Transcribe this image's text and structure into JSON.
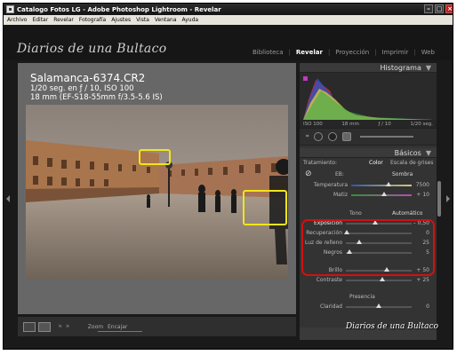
{
  "window": {
    "title": "Catalogo Fotos LG - Adobe Photoshop Lightroom - Revelar"
  },
  "menu": [
    "Archivo",
    "Editar",
    "Revelar",
    "Fotografía",
    "Ajustes",
    "Vista",
    "Ventana",
    "Ayuda"
  ],
  "identity_plate": "Diarios de una Bultaco",
  "modules": {
    "items": [
      "Biblioteca",
      "Revelar",
      "Proyección",
      "Imprimir",
      "Web"
    ],
    "active": "Revelar"
  },
  "image_info": {
    "filename": "Salamanca-6374.CR2",
    "exposure": "1/20 seg. en ƒ / 10, ISO 100",
    "lens": "18 mm (EF-S18-55mm f/3.5-5.6 IS)"
  },
  "toolbar": {
    "zoom_label": "Zoom",
    "zoom_value": "Encajar"
  },
  "histogram": {
    "title": "Histograma",
    "iso": "ISO 100",
    "focal": "18 mm",
    "aperture": "ƒ / 10",
    "shutter": "1/20 seg."
  },
  "basic": {
    "title": "Básicos",
    "treatment_label": "Tratamiento:",
    "treatment_color": "Color",
    "treatment_gray": "Escala de grises",
    "wb_label": "EB:",
    "wb_value": "Sombra",
    "temperature_label": "Temperatura",
    "temperature_value": "7500",
    "temperature_fraction": 0.62,
    "tint_label": "Matiz",
    "tint_value": "+ 10",
    "tint_fraction": 0.55,
    "tone_label": "Tono",
    "auto_label": "Automático",
    "exposure_label": "Exposición",
    "exposure_value": "– 0,50",
    "exposure_fraction": 0.44,
    "recovery_label": "Recuperación",
    "recovery_value": "0",
    "recovery_fraction": 0.02,
    "fill_label": "Luz de relleno",
    "fill_value": "25",
    "fill_fraction": 0.2,
    "blacks_label": "Negros",
    "blacks_value": "5",
    "blacks_fraction": 0.05,
    "brightness_label": "Brillo",
    "brightness_value": "+ 50",
    "brightness_fraction": 0.62,
    "contrast_label": "Contraste",
    "contrast_value": "+ 25",
    "contrast_fraction": 0.56,
    "presence_label": "Presencia",
    "clarity_label": "Claridad",
    "clarity_value": "0",
    "clarity_fraction": 0.5
  },
  "watermark": "Diarios de una Bultaco",
  "colors": {
    "highlight_yellow": "#f1e51a",
    "callout_red": "#d41010",
    "panel_bg": "#333333"
  }
}
